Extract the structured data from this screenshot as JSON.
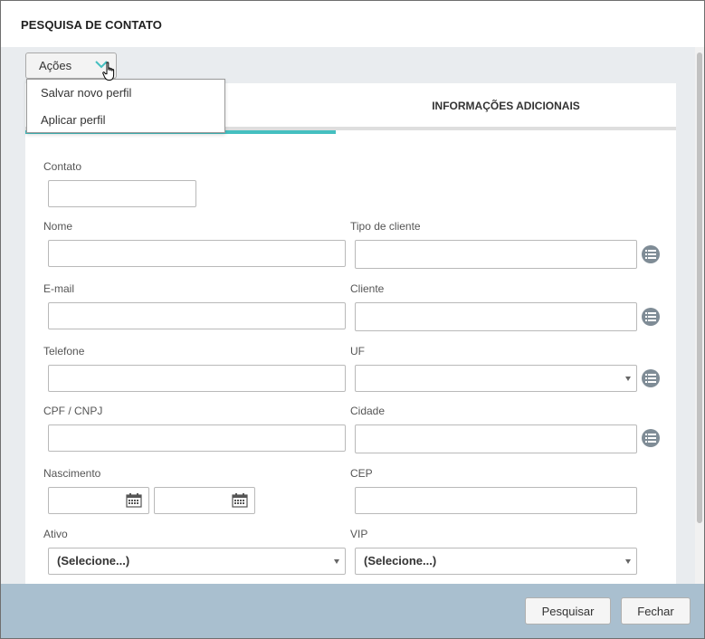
{
  "dialog": {
    "title": "PESQUISA DE CONTATO"
  },
  "actions": {
    "label": "Ações",
    "menu": [
      {
        "label": "Salvar novo perfil"
      },
      {
        "label": "Aplicar perfil"
      }
    ]
  },
  "tabs": [
    {
      "label": "",
      "active": true
    },
    {
      "label": "INFORMAÇÕES ADICIONAIS",
      "active": false
    }
  ],
  "form": {
    "contato": {
      "label": "Contato",
      "value": ""
    },
    "nome": {
      "label": "Nome",
      "value": ""
    },
    "tipo_cliente": {
      "label": "Tipo de cliente",
      "value": ""
    },
    "email": {
      "label": "E-mail",
      "value": ""
    },
    "cliente": {
      "label": "Cliente",
      "value": ""
    },
    "telefone": {
      "label": "Telefone",
      "value": ""
    },
    "uf": {
      "label": "UF",
      "value": ""
    },
    "cpf_cnpj": {
      "label": "CPF / CNPJ",
      "value": ""
    },
    "cidade": {
      "label": "Cidade",
      "value": ""
    },
    "nascimento": {
      "label": "Nascimento",
      "from": "",
      "to": ""
    },
    "cep": {
      "label": "CEP",
      "value": ""
    },
    "ativo": {
      "label": "Ativo",
      "value": "(Selecione...)"
    },
    "vip": {
      "label": "VIP",
      "value": "(Selecione...)"
    }
  },
  "footer": {
    "search_label": "Pesquisar",
    "close_label": "Fechar"
  },
  "colors": {
    "accent": "#45bfc0",
    "footer": "#a9bfcf",
    "list_icon": "#7f8c96"
  },
  "icons": {
    "list": "list-circle-icon",
    "calendar": "calendar-icon",
    "chevron": "chevron-down-icon",
    "cursor": "hand-pointer-icon"
  }
}
